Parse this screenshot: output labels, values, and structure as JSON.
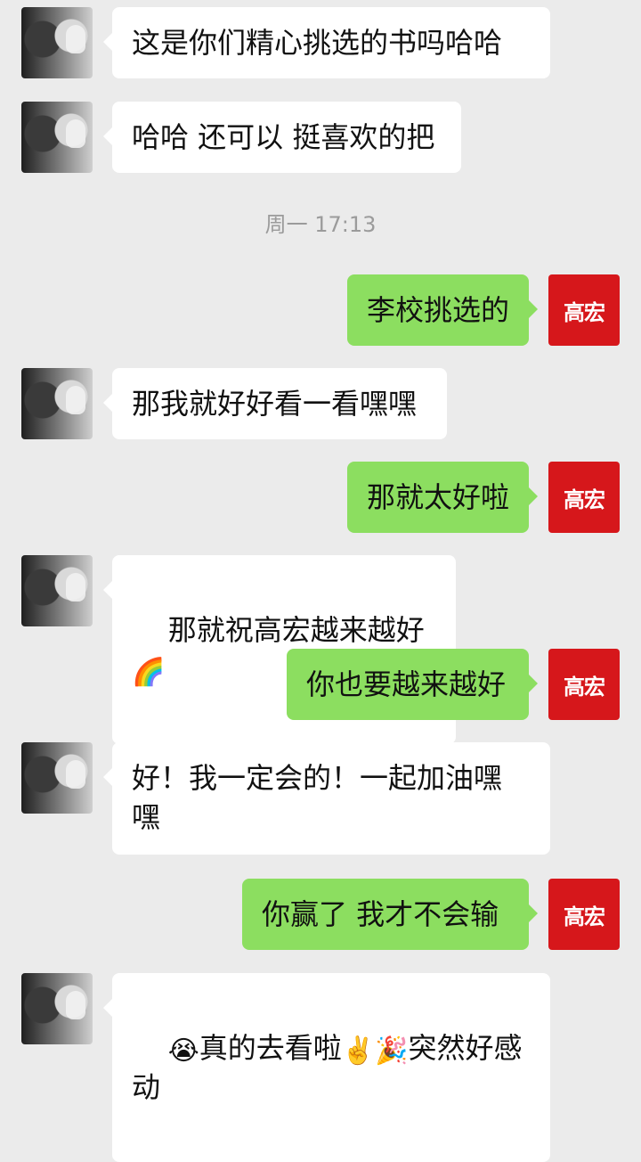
{
  "messages": [
    {
      "side": "left",
      "text": "这是你们精心挑选的书吗哈哈"
    },
    {
      "side": "left",
      "text": "哈哈 还可以 挺喜欢的把"
    },
    {
      "side": "right",
      "text": "李校挑选的"
    },
    {
      "side": "left",
      "text": "那我就好好看一看嘿嘿"
    },
    {
      "side": "right",
      "text": "那就太好啦"
    },
    {
      "side": "left",
      "text": "那就祝高宏越来越好"
    },
    {
      "side": "right",
      "text": "你也要越来越好"
    },
    {
      "side": "left",
      "text": "好！我一定会的！一起加油嘿\n嘿"
    },
    {
      "side": "right",
      "text": "你赢了 我才不会输"
    },
    {
      "side": "left",
      "text": "真的去看啦"
    }
  ],
  "timestamp": "周一 17:13",
  "logo_text": "高宏",
  "emoji": {
    "rainbow": "🌈",
    "crying": "😭",
    "victory": "✌️",
    "party": "🎉",
    "tail_text": "突然好感动"
  },
  "colors": {
    "background": "#ebebeb",
    "left_bubble": "#ffffff",
    "right_bubble": "#8cde60",
    "brand_red": "#d6171b",
    "timestamp": "#9b9b9b"
  }
}
